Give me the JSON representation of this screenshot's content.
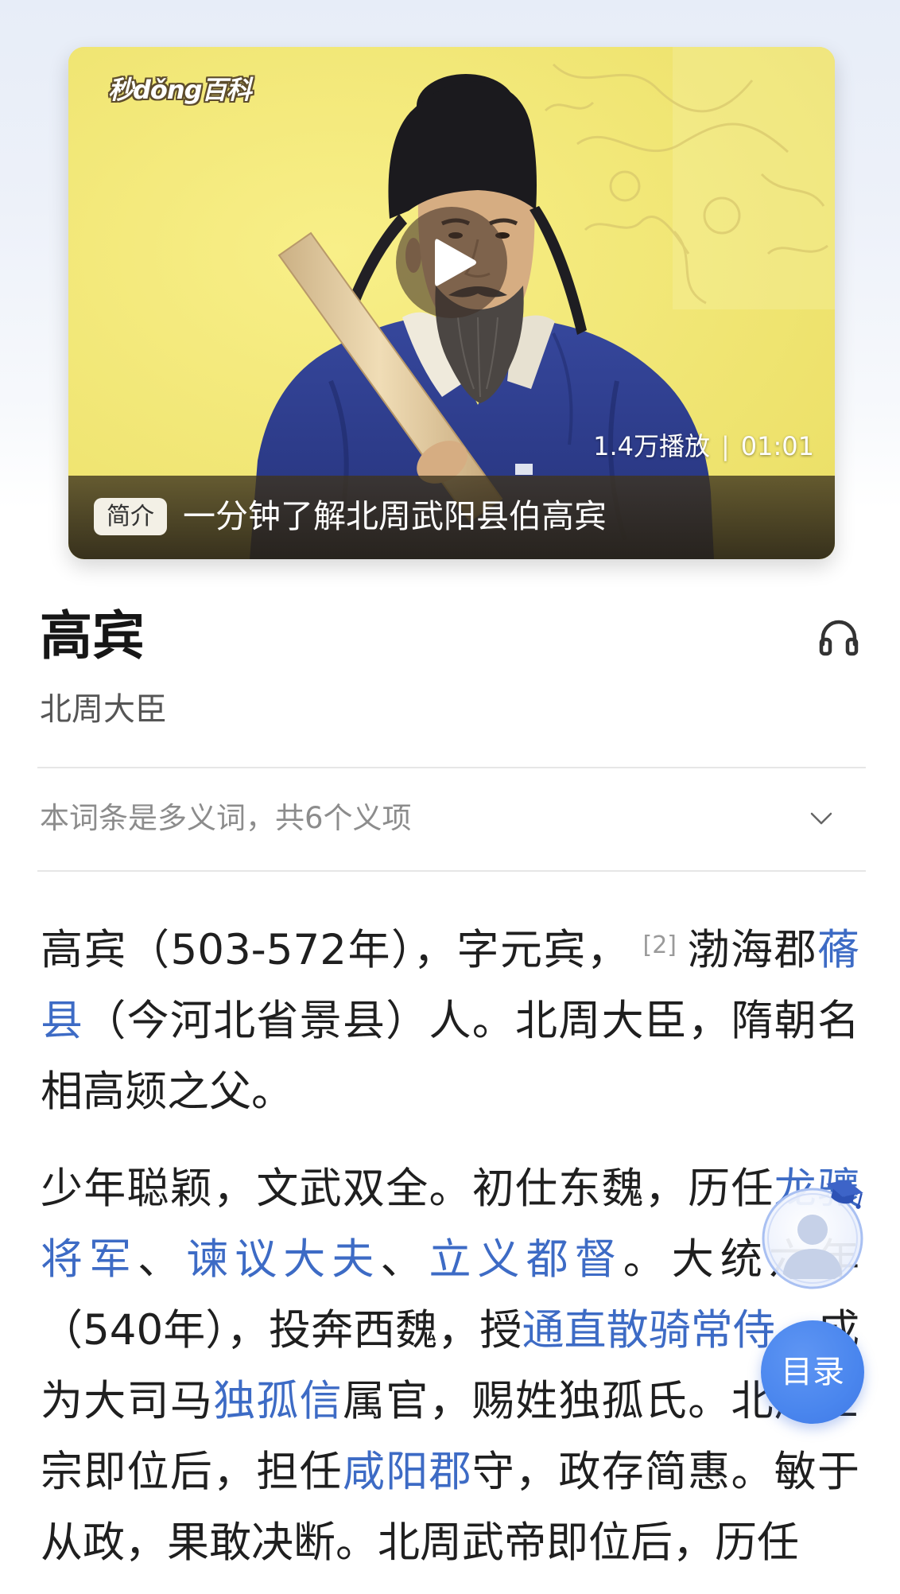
{
  "video": {
    "logo_text": "秒dǒng百科",
    "play_icon": "play-icon",
    "views": "1.4万播放",
    "separator": "|",
    "duration": "01:01",
    "badge": "简介",
    "caption": "一分钟了解北周武阳县伯高宾"
  },
  "entry": {
    "title": "高宾",
    "subtitle": "北周大臣",
    "listen_icon": "headphones-icon"
  },
  "polysemy": {
    "text": "本词条是多义词，共6个义项",
    "icon": "chevron-down-icon"
  },
  "paragraphs": [
    {
      "segments": [
        {
          "type": "text",
          "text": "高宾（503-572年），字元宾，"
        },
        {
          "type": "citation",
          "text": "[2]"
        },
        {
          "type": "text",
          "text": "渤海郡"
        },
        {
          "type": "link",
          "text": "蓨县"
        },
        {
          "type": "text",
          "text": "（今河北省景县）人。北周大臣，隋朝名相高颎之父。"
        }
      ]
    },
    {
      "segments": [
        {
          "type": "text",
          "text": "少年聪颖，文武双全。初仕东魏，历任"
        },
        {
          "type": "link",
          "text": "龙骧将军"
        },
        {
          "type": "text",
          "text": "、"
        },
        {
          "type": "link",
          "text": "谏议大夫"
        },
        {
          "type": "text",
          "text": "、"
        },
        {
          "type": "link",
          "text": "立义都督"
        },
        {
          "type": "text",
          "text": "。大统六年（540年），投奔西魏，授"
        },
        {
          "type": "link",
          "text": "通直散骑常侍"
        },
        {
          "type": "text",
          "text": "，成为大司马"
        },
        {
          "type": "link",
          "text": "独孤信"
        },
        {
          "type": "text",
          "text": "属官，赐姓独孤氏。北周世宗即位后，担任"
        },
        {
          "type": "link",
          "text": "咸阳郡"
        },
        {
          "type": "text",
          "text": "守，政存简惠。敏于从政，果敢决断。北周武帝即位后，历任"
        }
      ]
    }
  ],
  "floating": {
    "avatar_icon": "graduation-cap-avatar-icon",
    "toc_label": "目录"
  },
  "colors": {
    "link": "#3d6bc5",
    "toc_button": "#4a86ee",
    "thumbnail_background": "#f1e56c",
    "robe": "#2f3f8f"
  }
}
